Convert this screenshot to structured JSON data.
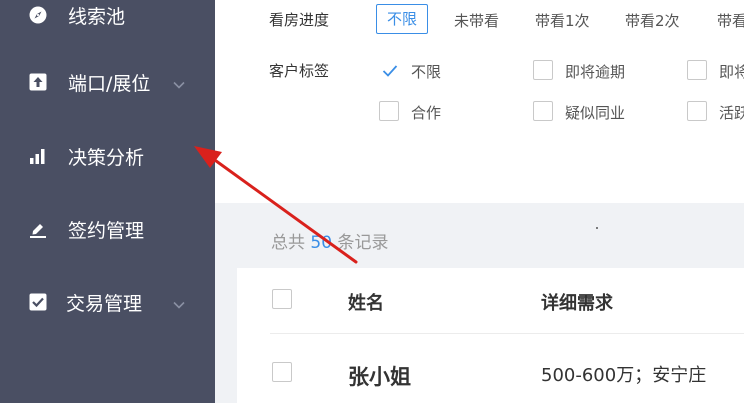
{
  "sidebar": {
    "items": [
      {
        "label": "线索池",
        "icon": "compass-icon",
        "has_chevron": false
      },
      {
        "label": "端口/展位",
        "icon": "upload-icon",
        "has_chevron": true
      },
      {
        "label": "决策分析",
        "icon": "bar-chart-icon",
        "has_chevron": false
      },
      {
        "label": "签约管理",
        "icon": "pencil-icon",
        "has_chevron": false
      },
      {
        "label": "交易管理",
        "icon": "checkbox-icon",
        "has_chevron": true
      }
    ]
  },
  "filters": {
    "viewing_progress": {
      "label": "看房进度",
      "options": [
        "不限",
        "未带看",
        "带看1次",
        "带看2次",
        "带看"
      ],
      "selected": "不限"
    },
    "customer_tags": {
      "label": "客户标签",
      "options": [
        {
          "label": "不限",
          "checked": true
        },
        {
          "label": "即将逾期",
          "checked": false
        },
        {
          "label": "即将",
          "checked": false
        },
        {
          "label": "合作",
          "checked": false
        },
        {
          "label": "疑似同业",
          "checked": false
        },
        {
          "label": "活跃",
          "checked": false
        }
      ]
    }
  },
  "summary": {
    "prefix": "总共",
    "count": "50",
    "suffix": "条记录"
  },
  "table": {
    "headers": [
      "姓名",
      "详细需求"
    ],
    "rows": [
      {
        "name": "张小姐",
        "requirement": "500-600万；安宁庄"
      }
    ]
  },
  "colors": {
    "sidebar_bg": "#4a4f63",
    "accent": "#3a8ee6",
    "annotation_arrow": "#d9211c"
  }
}
